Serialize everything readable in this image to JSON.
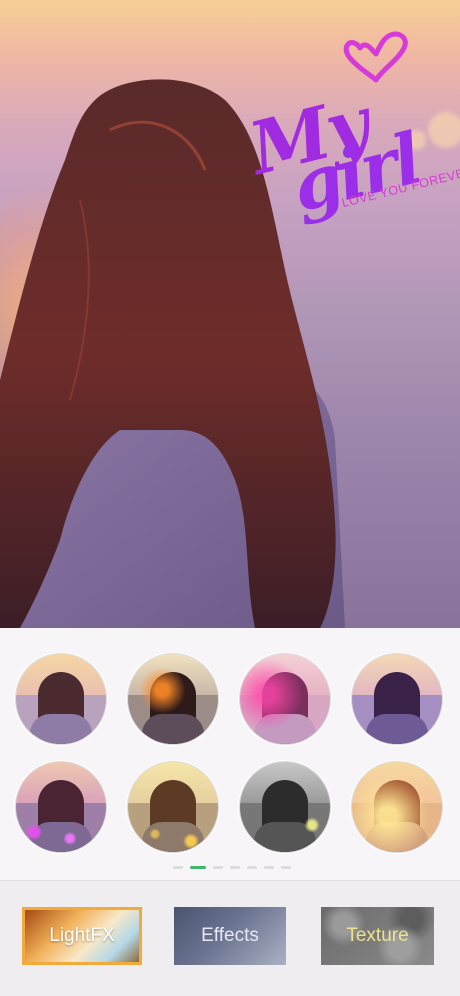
{
  "overlay": {
    "title_line1": "My",
    "title_line2": "girl",
    "subtitle": "LOVE YOU FOREVER",
    "accent_color": "#9b2ee8",
    "heart_icon": "heart-icon"
  },
  "filters": {
    "thumbnails": [
      {
        "style": "natural"
      },
      {
        "style": "sunflare"
      },
      {
        "style": "pink-leak"
      },
      {
        "style": "violet"
      },
      {
        "style": "sparkle"
      },
      {
        "style": "golden"
      },
      {
        "style": "mono"
      },
      {
        "style": "bright-flare"
      }
    ],
    "page_count": 7,
    "active_page": 2
  },
  "tabs": {
    "lightfx": "LightFX",
    "effects": "Effects",
    "texture": "Texture",
    "active": "LightFX",
    "active_border_color": "#f2aa3a"
  },
  "colors": {
    "pager_active": "#3fb86a",
    "pager_inactive": "#dcdcdc"
  }
}
